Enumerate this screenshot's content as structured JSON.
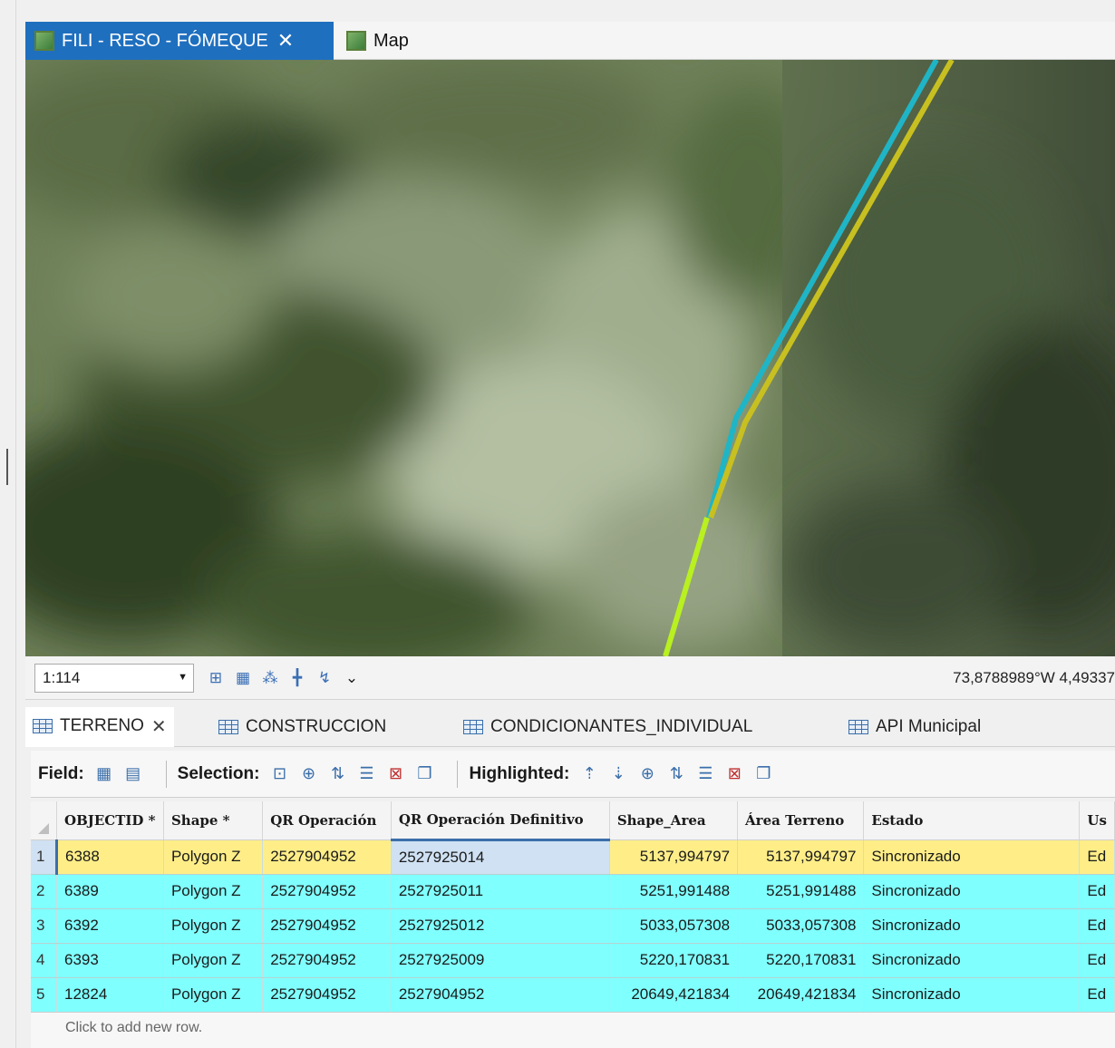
{
  "map_view": {
    "tabs": [
      {
        "label": "FILI - RESO - FÓMEQUE",
        "active": true
      },
      {
        "label": "Map",
        "active": false
      }
    ],
    "scale": "1:114",
    "coordinates": "73,8788989°W 4,49337",
    "line_colors": {
      "cyan": "#1fb5c6",
      "yellow": "#c8c020",
      "lime": "#b8f020"
    }
  },
  "table_tabs": [
    {
      "label": "TERRENO",
      "active": true
    },
    {
      "label": "CONSTRUCCION",
      "active": false
    },
    {
      "label": "CONDICIONANTES_INDIVIDUAL",
      "active": false
    },
    {
      "label": "API Municipal",
      "active": false
    }
  ],
  "toolbar": {
    "field_label": "Field:",
    "selection_label": "Selection:",
    "highlighted_label": "Highlighted:"
  },
  "table": {
    "columns": [
      "OBJECTID *",
      "Shape *",
      "QR Operación",
      "QR Operación Definitivo",
      "Shape_Area",
      "Área Terreno",
      "Estado",
      "Us"
    ],
    "rows": [
      {
        "row": "1",
        "objectid": "6388",
        "shape": "Polygon Z",
        "qr_operacion": "2527904952",
        "qr_definitivo": "2527925014",
        "shape_area": "5137,994797",
        "area_terreno": "5137,994797",
        "estado": "Sincronizado",
        "uso": "Ed",
        "state": "selected"
      },
      {
        "row": "2",
        "objectid": "6389",
        "shape": "Polygon Z",
        "qr_operacion": "2527904952",
        "qr_definitivo": "2527925011",
        "shape_area": "5251,991488",
        "area_terreno": "5251,991488",
        "estado": "Sincronizado",
        "uso": "Ed",
        "state": "highlighted"
      },
      {
        "row": "3",
        "objectid": "6392",
        "shape": "Polygon Z",
        "qr_operacion": "2527904952",
        "qr_definitivo": "2527925012",
        "shape_area": "5033,057308",
        "area_terreno": "5033,057308",
        "estado": "Sincronizado",
        "uso": "Ed",
        "state": "highlighted"
      },
      {
        "row": "4",
        "objectid": "6393",
        "shape": "Polygon Z",
        "qr_operacion": "2527904952",
        "qr_definitivo": "2527925009",
        "shape_area": "5220,170831",
        "area_terreno": "5220,170831",
        "estado": "Sincronizado",
        "uso": "Ed",
        "state": "highlighted"
      },
      {
        "row": "5",
        "objectid": "12824",
        "shape": "Polygon Z",
        "qr_operacion": "2527904952",
        "qr_definitivo": "2527904952",
        "shape_area": "20649,421834",
        "area_terreno": "20649,421834",
        "estado": "Sincronizado",
        "uso": "Ed",
        "state": "highlighted"
      }
    ],
    "footer": "Click to add new row."
  },
  "colors": {
    "active_tab": "#1f6fbf",
    "highlight_row": "#80ffff",
    "selected_row": "#ffee88",
    "selected_cell": "#cfe1f3"
  }
}
